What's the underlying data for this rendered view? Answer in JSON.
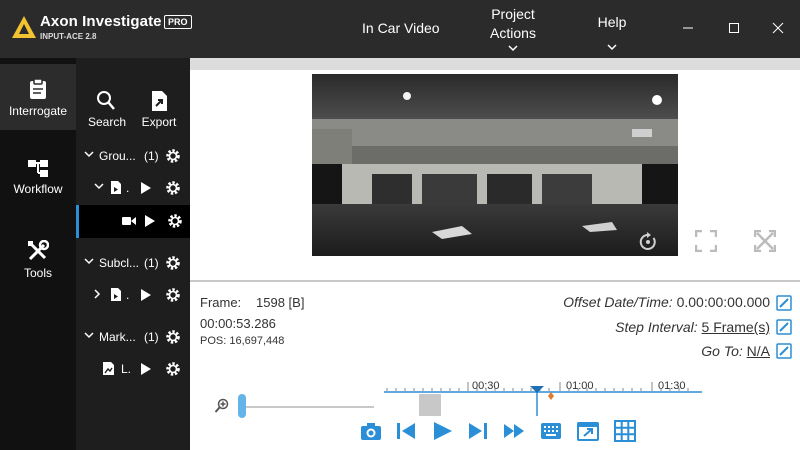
{
  "titlebar": {
    "app_name": "Axon Investigate",
    "badge": "PRO",
    "version": "INPUT-ACE 2.8",
    "menu": {
      "in_car_video": "In Car Video",
      "project_line1": "Project",
      "project_line2": "Actions",
      "help": "Help"
    }
  },
  "rail": {
    "interrogate": "Interrogate",
    "workflow": "Workflow",
    "tools": "Tools"
  },
  "tree": {
    "search": "Search",
    "export": "Export",
    "groups_label": "Grou...",
    "groups_count": "(1)",
    "subclips_label": "Subcl...",
    "subclips_count": "(1)",
    "markers_label": "Mark...",
    "markers_count": "(1)",
    "file_label": ".",
    "marker_file_label": "L."
  },
  "info": {
    "frame_label": "Frame:",
    "frame_value": "1598 [B]",
    "timecode": "00:00:53.286",
    "pos": "POS: 16,697,448",
    "offset_label": "Offset Date/Time:",
    "offset_value": "0.00:00:00.000",
    "step_label": "Step Interval:",
    "step_value": "5 Frame(s)",
    "goto_label": "Go To:",
    "goto_value": "N/A"
  },
  "timeline": {
    "ticks": [
      "00:30",
      "01:00",
      "01:30"
    ]
  },
  "colors": {
    "accent": "#2a8fd6",
    "marker": "#e07a2e"
  }
}
